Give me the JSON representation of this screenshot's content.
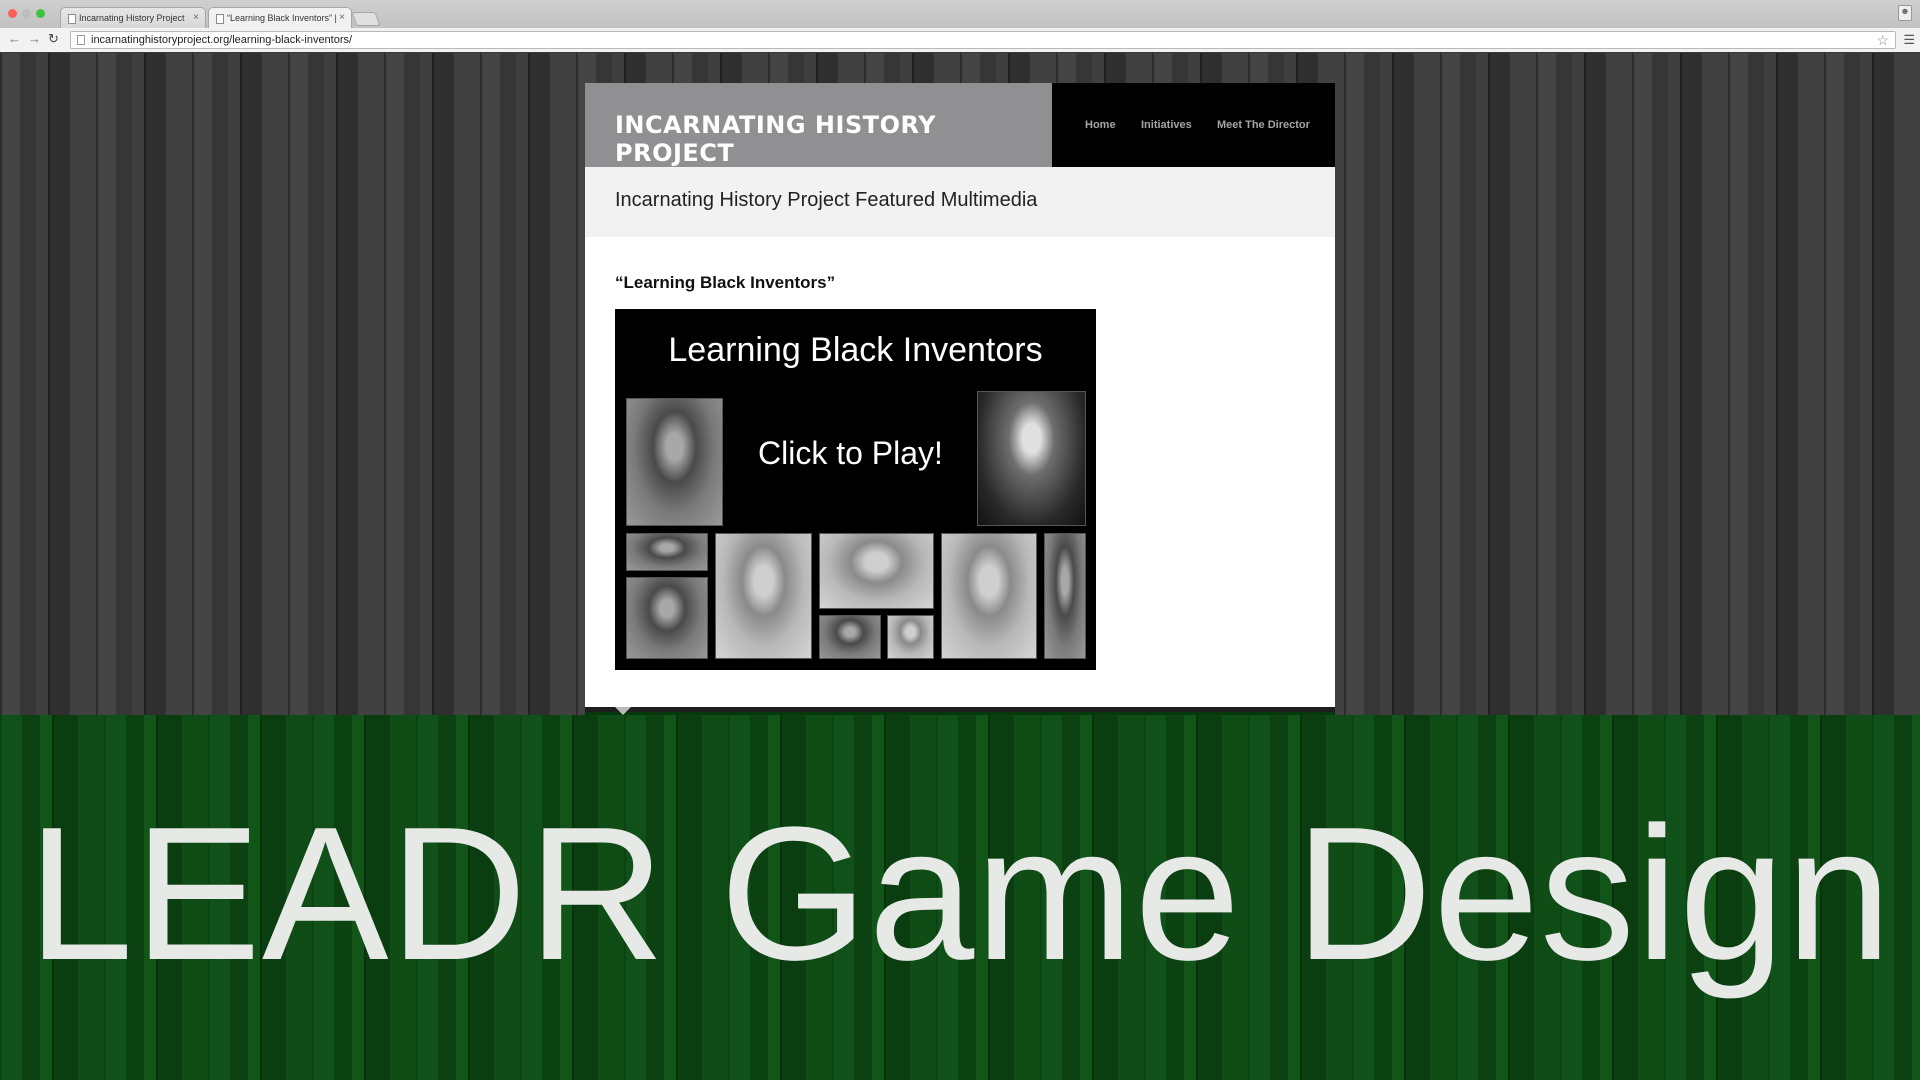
{
  "browser": {
    "tabs": [
      {
        "title": "Incarnating History Project",
        "active": false
      },
      {
        "title": "“Learning Black Inventors” | ",
        "active": true
      }
    ],
    "url": "incarnatinghistoryproject.org/learning-black-inventors/"
  },
  "site": {
    "title": "INCARNATING HISTORY PROJECT",
    "nav": [
      "Home",
      "Initiatives",
      "Meet The Director"
    ],
    "page_heading": "Incarnating History Project Featured Multimedia",
    "post_title": "“Learning Black Inventors”",
    "video": {
      "title": "Learning Black Inventors",
      "play_label": "Click to Play!"
    }
  },
  "banner": {
    "text": "LEADR Game Design"
  },
  "colors": {
    "header_bg": "#000000",
    "title_box": "#909092",
    "banner_green": "#0e4a14"
  }
}
